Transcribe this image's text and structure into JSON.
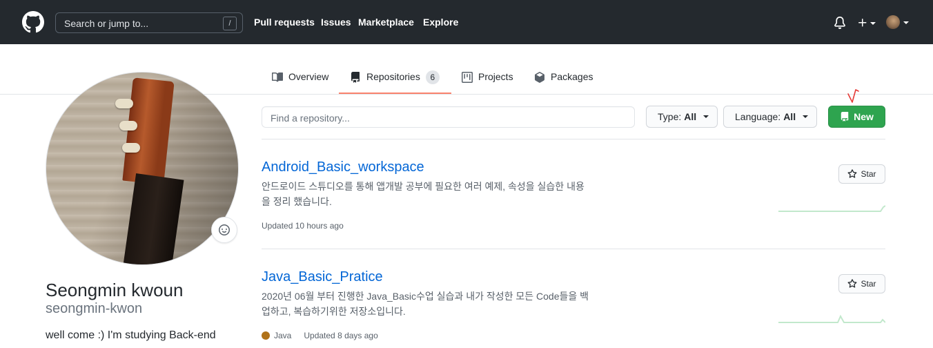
{
  "header": {
    "search_placeholder": "Search or jump to...",
    "search_shortcut": "/",
    "nav": [
      "Pull requests",
      "Issues",
      "Marketplace",
      "Explore"
    ]
  },
  "tabs": [
    {
      "label": "Overview",
      "icon": "book-icon"
    },
    {
      "label": "Repositories",
      "icon": "repo-icon",
      "count": "6",
      "selected": true
    },
    {
      "label": "Projects",
      "icon": "project-icon"
    },
    {
      "label": "Packages",
      "icon": "package-icon"
    }
  ],
  "profile": {
    "name": "Seongmin kwoun",
    "login": "seongmin-kwon",
    "bio": "well come :) I'm studying Back-end"
  },
  "filters": {
    "find_placeholder": "Find a repository...",
    "type_label": "Type:",
    "type_value": "All",
    "language_label": "Language:",
    "language_value": "All",
    "new_label": "New"
  },
  "repos": [
    {
      "name": "Android_Basic_workspace",
      "description": "안드로이드 스튜디오를 통해 앱개발 공부에 필요한 여러 예제, 속성을 실습한 내용을 정리 했습니다.",
      "language": "",
      "updated": "Updated 10 hours ago",
      "star_label": "Star"
    },
    {
      "name": "Java_Basic_Pratice",
      "description": "2020년 06월 부터 진행한 Java_Basic수업 실습과 내가 작성한 모든 Code들을 백업하고, 복습하기위한 저장소입니다.",
      "language": "Java",
      "updated": "Updated 8 days ago",
      "star_label": "Star"
    }
  ],
  "colors": {
    "header_bg": "#24292e",
    "link": "#0366d6",
    "new_button": "#2ea44f",
    "tab_underline": "#f9826c",
    "java": "#b07219",
    "sparkline": "#c2e8cc"
  }
}
